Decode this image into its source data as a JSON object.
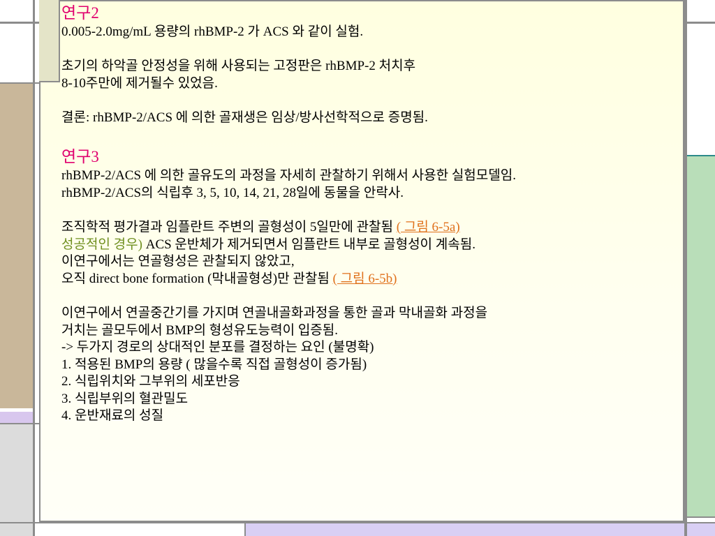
{
  "study2": {
    "heading": "연구2",
    "lines": [
      "0.005-2.0mg/mL 용량의 rhBMP-2 가 ACS 와 같이 실험.",
      "",
      "초기의 하악골 안정성을 위해 사용되는 고정판은 rhBMP-2 처치후",
      "8-10주만에 제거될수 있었음.",
      "",
      "결론: rhBMP-2/ACS 에 의한 골재생은 임상/방사선학적으로 증명됨."
    ]
  },
  "study3": {
    "heading": "연구3",
    "line1": "rhBMP-2/ACS 에 의한 골유도의 과정을 자세히 관찰하기 위해서 사용한 실험모델임.",
    "line2": "rhBMP-2/ACS의 식립후 3, 5, 10, 14, 21, 28일에 동물을 안락사.",
    "histo_text": "조직학적 평가결과 임플란트 주변의 골형성이 5일만에 관찰됨 ",
    "fig_a": "( 그림 6-5a)",
    "success_label": "성공적인 경우)",
    "success_text": " ACS 운반체가 제거되면서 임플란트 내부로 골형성이 계속됨.",
    "line_no_endo": "이연구에서는 연골형성은 관찰되지 않았고,",
    "direct_text": "오직 direct bone formation (막내골형성)만 관찰됨 ",
    "fig_b": "( 그림 6-5b)",
    "concl1": "이연구에서 연골중간기를 가지며 연골내골화과정을 통한 골과 막내골화 과정을",
    "concl2": "거치는 골모두에서 BMP의 형성유도능력이 입증됨.",
    "arrow_line": "->  두가지 경로의 상대적인 분포를 결정하는 요인 (불명확)",
    "factors": [
      " 1. 적용된 BMP의 용량 ( 많을수록 직접 골형성이 증가됨)",
      " 2. 식립위치와 그부위의 세포반응",
      " 3. 식립부위의 혈관밀도",
      " 4. 운반재료의 성질"
    ]
  },
  "colors": {
    "heading": "#e0006e",
    "link": "#e0711c",
    "success_label": "#6f8f1f",
    "panel": "#ffffe0"
  }
}
